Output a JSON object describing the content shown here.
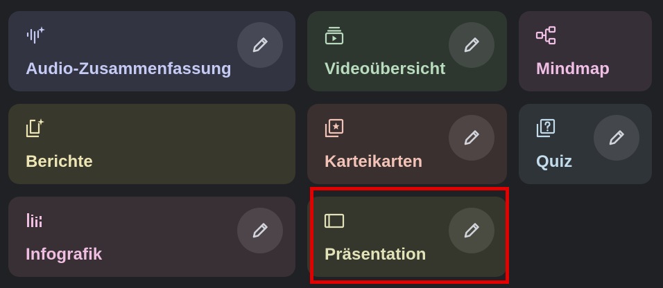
{
  "edit_icon": "pencil-icon",
  "highlight_color": "#e50000",
  "cards": [
    {
      "id": "audio",
      "label": "Audio-Zusammenfassung",
      "icon": "audio-waveform-sparkle-icon",
      "color": "#c6cbf5",
      "editable": true
    },
    {
      "id": "video",
      "label": "Videoübersicht",
      "icon": "video-player-icon",
      "color": "#b8dcbd",
      "editable": true
    },
    {
      "id": "mindmap",
      "label": "Mindmap",
      "icon": "mindmap-icon",
      "color": "#f0bfe6",
      "editable": false
    },
    {
      "id": "report",
      "label": "Berichte",
      "icon": "reports-sparkle-icon",
      "color": "#ede6b4",
      "editable": false
    },
    {
      "id": "cards",
      "label": "Karteikarten",
      "icon": "flashcards-icon",
      "color": "#f4c3b7",
      "editable": true
    },
    {
      "id": "quiz",
      "label": "Quiz",
      "icon": "quiz-icon",
      "color": "#c2dcec",
      "editable": true
    },
    {
      "id": "info",
      "label": "Infografik",
      "icon": "infographic-icon",
      "color": "#efbee1",
      "editable": true
    },
    {
      "id": "pres",
      "label": "Präsentation",
      "icon": "presentation-icon",
      "color": "#e2e3b9",
      "editable": true
    }
  ]
}
